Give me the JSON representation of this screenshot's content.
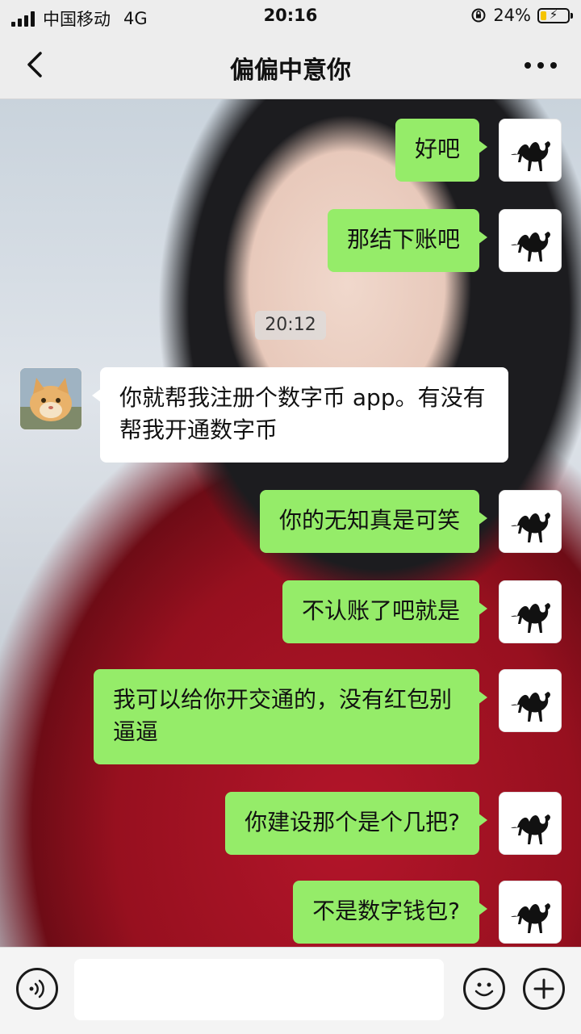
{
  "status_bar": {
    "carrier": "中国移动",
    "network": "4G",
    "time": "20:16",
    "battery_percent": "24%",
    "battery_level": 0.24
  },
  "header": {
    "title": "偏偏中意你"
  },
  "chat": {
    "timestamp": "20:12",
    "messages": [
      {
        "sender": "me",
        "text": "好吧"
      },
      {
        "sender": "me",
        "text": "那结下账吧"
      },
      {
        "sender": "them",
        "text": "你就帮我注册个数字币 app。有没有帮我开通数字币"
      },
      {
        "sender": "me",
        "text": "你的无知真是可笑"
      },
      {
        "sender": "me",
        "text": "不认账了吧就是"
      },
      {
        "sender": "me",
        "text": "我可以给你开交通的，没有红包别逼逼"
      },
      {
        "sender": "me",
        "text": "你建设那个是个几把?"
      },
      {
        "sender": "me",
        "text": "不是数字钱包?"
      }
    ]
  },
  "input_bar": {
    "placeholder": ""
  },
  "colors": {
    "my_bubble": "#95ec69",
    "their_bubble": "#ffffff",
    "bar_background": "#ededed"
  }
}
